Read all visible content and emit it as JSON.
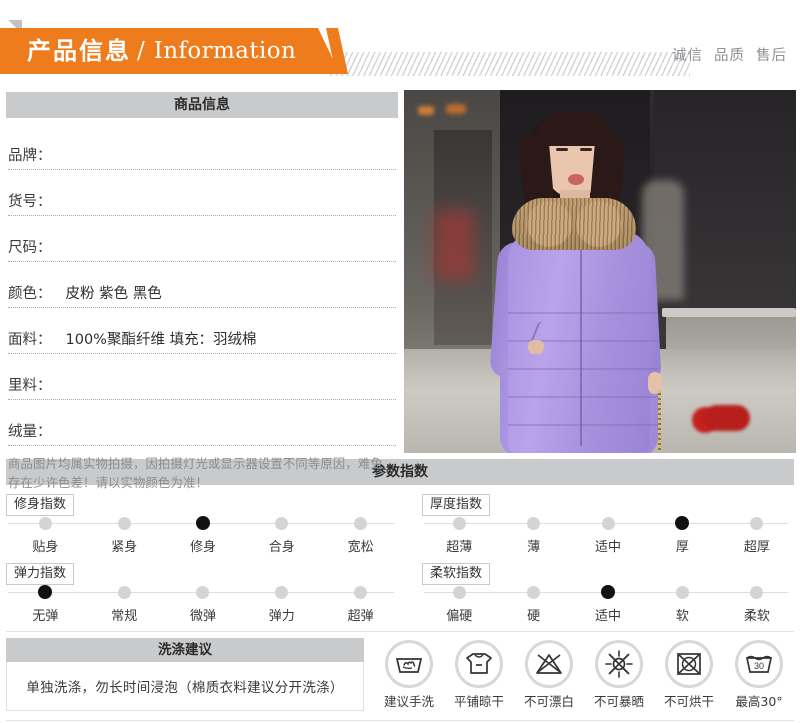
{
  "header": {
    "title_cn": "产品信息",
    "separator": "/",
    "title_en": "Information",
    "tags": [
      "诚信",
      "品质",
      "售后"
    ]
  },
  "product_info": {
    "section_title": "商品信息",
    "rows": [
      {
        "label": "品牌：",
        "value": ""
      },
      {
        "label": "货号：",
        "value": ""
      },
      {
        "label": "尺码：",
        "value": ""
      },
      {
        "label": "颜色：",
        "value": "皮粉 紫色 黑色"
      },
      {
        "label": "面料：",
        "value": "100%聚酯纤维  填充：羽绒棉"
      },
      {
        "label": "里料：",
        "value": ""
      },
      {
        "label": "绒量：",
        "value": ""
      }
    ],
    "disclaimer": "商品图片均属实物拍摄，因拍摄灯光或显示器设置不同等原因，难免存在少许色差！请以实物颜色为准！"
  },
  "photo": {
    "alt": "model-wearing-purple-down-coat",
    "coat_color": "#b09be6"
  },
  "parameters": {
    "section_title": "参数指数",
    "indices": [
      {
        "name": "修身指数",
        "options": [
          "贴身",
          "紧身",
          "修身",
          "合身",
          "宽松"
        ],
        "selected": 2
      },
      {
        "name": "弹力指数",
        "options": [
          "无弹",
          "常规",
          "微弹",
          "弹力",
          "超弹"
        ],
        "selected": 0
      },
      {
        "name": "厚度指数",
        "options": [
          "超薄",
          "薄",
          "适中",
          "厚",
          "超厚"
        ],
        "selected": 3
      },
      {
        "name": "柔软指数",
        "options": [
          "偏硬",
          "硬",
          "适中",
          "软",
          "柔软"
        ],
        "selected": 2
      }
    ]
  },
  "wash": {
    "section_title": "洗涤建议",
    "advice": "单独洗涤，勿长时间浸泡（棉质衣料建议分开洗涤）",
    "care_symbols": [
      {
        "icon": "hand-wash-icon",
        "label": "建议手洗"
      },
      {
        "icon": "dry-flat-icon",
        "label": "平铺晾干"
      },
      {
        "icon": "no-bleach-icon",
        "label": "不可漂白"
      },
      {
        "icon": "no-sun-dry-icon",
        "label": "不可暴晒"
      },
      {
        "icon": "no-tumble-dry-icon",
        "label": "不可烘干"
      },
      {
        "icon": "max-temp-icon",
        "label": "最高30°",
        "temp": "30"
      }
    ]
  },
  "colors": {
    "accent_orange": "#ef7c1c",
    "band_gray": "#c8cacc",
    "dot_active": "#111111",
    "dot_inactive": "#d2d4d6"
  }
}
